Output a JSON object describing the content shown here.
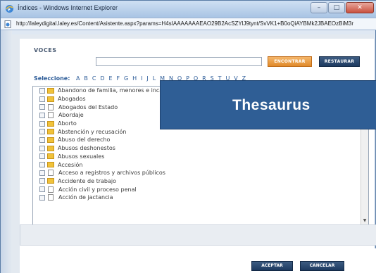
{
  "window": {
    "title": "Índices - Windows Internet Explorer",
    "url": "http://laleydigital.laley.es/Content/Asistente.aspx?params=H4sIAAAAAAAEAO29B2AcSZYlJ9tynt/SvVK1+B0oQiAYBMk2JBAEOzBiM3r",
    "buttons": {
      "minimize": "–",
      "maximize": "□",
      "close": "✕"
    }
  },
  "voces": {
    "label": "VOCES",
    "search_value": "",
    "encontrar_label": "ENCONTRAR",
    "restaurar_label": "RESTAURAR"
  },
  "alphabet": {
    "label": "Seleccione:",
    "letters": [
      "A",
      "B",
      "C",
      "D",
      "E",
      "F",
      "G",
      "H",
      "I",
      "J",
      "L",
      "M",
      "N",
      "O",
      "P",
      "Q",
      "R",
      "S",
      "T",
      "U",
      "V",
      "Z"
    ]
  },
  "list": {
    "items": [
      {
        "label": "Abandono de familia, menores e incapaces",
        "icon": "folder-icon"
      },
      {
        "label": "Abogados",
        "icon": "folder-icon"
      },
      {
        "label": "Abogados del Estado",
        "icon": "document-icon"
      },
      {
        "label": "Abordaje",
        "icon": "document-icon"
      },
      {
        "label": "Aborto",
        "icon": "folder-icon"
      },
      {
        "label": "Abstención y recusación",
        "icon": "folder-icon"
      },
      {
        "label": "Abuso del derecho",
        "icon": "folder-icon"
      },
      {
        "label": "Abusos deshonestos",
        "icon": "folder-icon"
      },
      {
        "label": "Abusos sexuales",
        "icon": "folder-icon"
      },
      {
        "label": "Accesión",
        "icon": "folder-icon"
      },
      {
        "label": "Acceso a registros y archivos públicos",
        "icon": "document-icon"
      },
      {
        "label": "Accidente de trabajo",
        "icon": "folder-icon"
      },
      {
        "label": "Acción civil y proceso penal",
        "icon": "document-icon"
      },
      {
        "label": "Acción de jactancia",
        "icon": "document-icon"
      }
    ]
  },
  "banner": {
    "text": "Thesaurus"
  },
  "footer": {
    "aceptar_label": "ACEPTAR",
    "cancelar_label": "CANCELAR"
  },
  "colors": {
    "accent_orange": "#e08a2b",
    "navy_button": "#1d3a60",
    "link_blue": "#2a5a97",
    "banner_blue": "#2f5e95",
    "folder_yellow": "#f0c23a"
  }
}
